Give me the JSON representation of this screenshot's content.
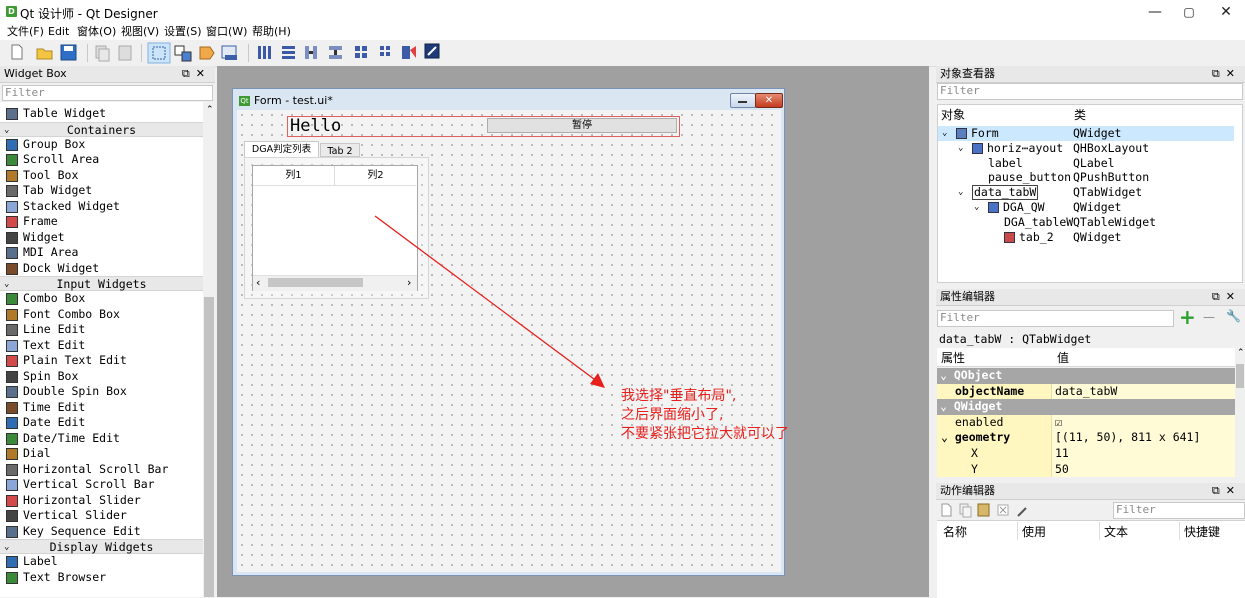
{
  "window": {
    "title": "Qt 设计师 - Qt Designer",
    "app_icon": "D",
    "minimize": "—",
    "maximize": "▢",
    "close": "✕"
  },
  "menubar": [
    "文件(F)",
    "Edit",
    "窗体(O)",
    "视图(V)",
    "设置(S)",
    "窗口(W)",
    "帮助(H)"
  ],
  "toolbar_icons": [
    "new-icon",
    "open-icon",
    "save-icon",
    "copy-icon",
    "paste-icon",
    "edit-widgets-icon",
    "edit-signals-icon",
    "edit-buddies-icon",
    "edit-tab-order-icon",
    "layout-horizontal-icon",
    "layout-vertical-icon",
    "layout-h-splitter-icon",
    "layout-v-splitter-icon",
    "layout-grid-icon",
    "layout-form-icon",
    "break-layout-icon",
    "adjust-size-icon"
  ],
  "widget_box": {
    "title": "Widget Box",
    "float_btn": "⧉",
    "close_btn": "✕",
    "filter_placeholder": "Filter",
    "items": [
      {
        "kind": "item",
        "label": "Table Widget",
        "icon": "table-widget-icon"
      },
      {
        "kind": "cat",
        "label": "Containers"
      },
      {
        "kind": "item",
        "label": "Group Box",
        "icon": "group-box-icon"
      },
      {
        "kind": "item",
        "label": "Scroll Area",
        "icon": "scroll-area-icon"
      },
      {
        "kind": "item",
        "label": "Tool Box",
        "icon": "tool-box-icon"
      },
      {
        "kind": "item",
        "label": "Tab Widget",
        "icon": "tab-widget-icon"
      },
      {
        "kind": "item",
        "label": "Stacked Widget",
        "icon": "stacked-widget-icon"
      },
      {
        "kind": "item",
        "label": "Frame",
        "icon": "frame-icon"
      },
      {
        "kind": "item",
        "label": "Widget",
        "icon": "widget-icon"
      },
      {
        "kind": "item",
        "label": "MDI Area",
        "icon": "mdi-area-icon"
      },
      {
        "kind": "item",
        "label": "Dock Widget",
        "icon": "dock-widget-icon"
      },
      {
        "kind": "cat",
        "label": "Input Widgets"
      },
      {
        "kind": "item",
        "label": "Combo Box",
        "icon": "combo-box-icon"
      },
      {
        "kind": "item",
        "label": "Font Combo Box",
        "icon": "font-combo-box-icon"
      },
      {
        "kind": "item",
        "label": "Line Edit",
        "icon": "line-edit-icon"
      },
      {
        "kind": "item",
        "label": "Text Edit",
        "icon": "text-edit-icon"
      },
      {
        "kind": "item",
        "label": "Plain Text Edit",
        "icon": "plain-text-edit-icon"
      },
      {
        "kind": "item",
        "label": "Spin Box",
        "icon": "spin-box-icon"
      },
      {
        "kind": "item",
        "label": "Double Spin Box",
        "icon": "double-spin-box-icon"
      },
      {
        "kind": "item",
        "label": "Time Edit",
        "icon": "time-edit-icon"
      },
      {
        "kind": "item",
        "label": "Date Edit",
        "icon": "date-edit-icon"
      },
      {
        "kind": "item",
        "label": "Date/Time Edit",
        "icon": "date-time-edit-icon"
      },
      {
        "kind": "item",
        "label": "Dial",
        "icon": "dial-icon"
      },
      {
        "kind": "item",
        "label": "Horizontal Scroll Bar",
        "icon": "horizontal-scroll-bar-icon"
      },
      {
        "kind": "item",
        "label": "Vertical Scroll Bar",
        "icon": "vertical-scroll-bar-icon"
      },
      {
        "kind": "item",
        "label": "Horizontal Slider",
        "icon": "horizontal-slider-icon"
      },
      {
        "kind": "item",
        "label": "Vertical Slider",
        "icon": "vertical-slider-icon"
      },
      {
        "kind": "item",
        "label": "Key Sequence Edit",
        "icon": "key-sequence-edit-icon"
      },
      {
        "kind": "cat",
        "label": "Display Widgets"
      },
      {
        "kind": "item",
        "label": "Label",
        "icon": "label-icon"
      },
      {
        "kind": "item",
        "label": "Text Browser",
        "icon": "text-browser-icon"
      }
    ]
  },
  "form": {
    "title": "Form - test.ui*",
    "icon": "Qt",
    "label_text": "Hello",
    "pause_button": "暂停",
    "tabs": [
      "DGA判定列表",
      "Tab 2"
    ],
    "table_headers": [
      "列1",
      "列2"
    ],
    "scroll_left": "‹",
    "scroll_right": "›"
  },
  "annotation": {
    "lines": [
      "我选择\"垂直布局\",",
      "之后界面缩小了,",
      "不要紧张把它拉大就可以了"
    ],
    "color": "#e8201c"
  },
  "object_inspector": {
    "title": "对象查看器",
    "filter_placeholder": "Filter",
    "col_object": "对象",
    "col_class": "类",
    "rows": [
      {
        "name": "Form",
        "cls": "QWidget",
        "depth": 0,
        "arrow": "⌄",
        "icon": "form-icon",
        "selected": true
      },
      {
        "name": "horiz⋯ayout",
        "cls": "QHBoxLayout",
        "depth": 1,
        "arrow": "⌄",
        "icon": "hbox-layout-icon"
      },
      {
        "name": "label",
        "cls": "QLabel",
        "depth": 2,
        "arrow": "",
        "icon": ""
      },
      {
        "name": "pause_button",
        "cls": "QPushButton",
        "depth": 2,
        "arrow": "",
        "icon": ""
      },
      {
        "name": "data_tabW",
        "cls": "QTabWidget",
        "depth": 1,
        "arrow": "⌄",
        "icon": "",
        "boxed": true
      },
      {
        "name": "DGA_QW",
        "cls": "QWidget",
        "depth": 2,
        "arrow": "⌄",
        "icon": "vbox-layout-icon"
      },
      {
        "name": "DGA_tableW",
        "cls": "QTableWidget",
        "depth": 3,
        "arrow": "",
        "icon": ""
      },
      {
        "name": "tab_2",
        "cls": "QWidget",
        "depth": 3,
        "arrow": "",
        "icon": "widget-red-icon"
      }
    ]
  },
  "property_editor": {
    "title": "属性编辑器",
    "filter_placeholder": "Filter",
    "add_btn": "+",
    "remove_btn": "—",
    "config_btn": "🔧",
    "object_line": "data_tabW : QTabWidget",
    "col_prop": "属性",
    "col_value": "值",
    "rows": [
      {
        "kind": "group",
        "key": "QObject"
      },
      {
        "kind": "prop",
        "key": "objectName",
        "value": "data_tabW",
        "bold": true
      },
      {
        "kind": "group",
        "key": "QWidget"
      },
      {
        "kind": "prop",
        "key": "enabled",
        "value": "☑"
      },
      {
        "kind": "prop",
        "key": "geometry",
        "value": "[(11, 50), 811 x 641]",
        "bold": true,
        "arrow": "⌄"
      },
      {
        "kind": "sub",
        "key": "X",
        "value": "11"
      },
      {
        "kind": "sub",
        "key": "Y",
        "value": "50"
      }
    ]
  },
  "action_editor": {
    "title": "动作编辑器",
    "filter_placeholder": "Filter",
    "cols": [
      "名称",
      "使用",
      "文本",
      "快捷键"
    ]
  },
  "colors": {
    "group_header": "#a6a6a6",
    "prop_yellow": "#fffbd6",
    "prop_yellow_key": "#fff6c0",
    "selection": "#cce8ff"
  }
}
